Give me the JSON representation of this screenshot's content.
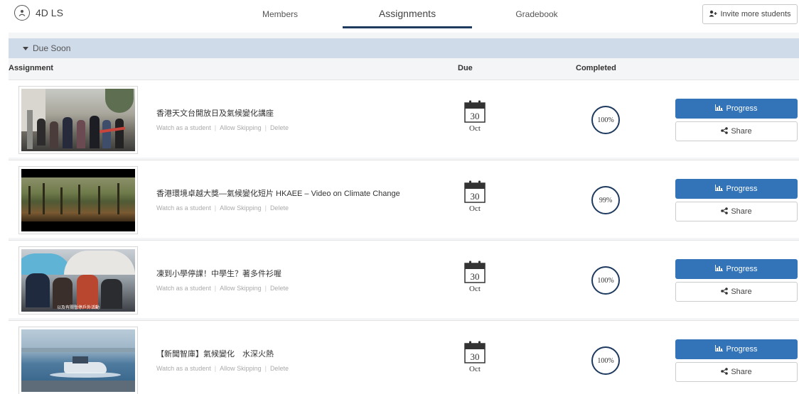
{
  "header": {
    "class_name": "4D LS",
    "tabs": [
      {
        "label": "Members",
        "active": false
      },
      {
        "label": "Assignments",
        "active": true
      },
      {
        "label": "Gradebook",
        "active": false
      }
    ],
    "invite_label": "Invite more students"
  },
  "section": {
    "title": "Due Soon",
    "columns": {
      "assignment": "Assignment",
      "due": "Due",
      "completed": "Completed"
    }
  },
  "links": {
    "watch": "Watch as a student",
    "skip": "Allow Skipping",
    "delete": "Delete",
    "separator": "|"
  },
  "buttons": {
    "progress": "Progress",
    "share": "Share"
  },
  "assignments": [
    {
      "title": "香港天文台開放日及氣候變化講座",
      "due_day": "30",
      "due_month": "Oct",
      "completed": "100%"
    },
    {
      "title": "香港環境卓越大獎—氣候變化短片 HKAEE – Video on Climate Change",
      "due_day": "30",
      "due_month": "Oct",
      "completed": "99%"
    },
    {
      "title": "凍到小學停課！中學生？著多件衫喔",
      "due_day": "30",
      "due_month": "Oct",
      "completed": "100%"
    },
    {
      "title": "【新聞智庫】氣候變化　水深火熱",
      "due_day": "30",
      "due_month": "Oct",
      "completed": "100%"
    }
  ],
  "thumb_captions": {
    "row3": "以及有關暫停戶外活動"
  },
  "colors": {
    "accent": "#1e3a5f",
    "progress_button": "#3374b8",
    "section_header": "#cfdbe9"
  }
}
